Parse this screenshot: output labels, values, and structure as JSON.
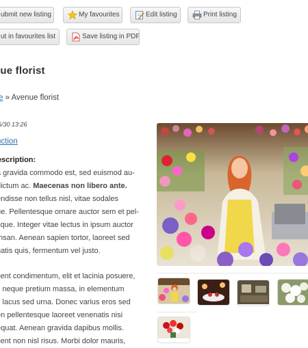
{
  "toolbar": {
    "submit_label": "ubmit new listing",
    "favourites_label": "My favourites",
    "edit_label": "Edit listing",
    "print_label": "Print listing",
    "put_fav_label": "ut in favourites list",
    "pdf_label": "Save listing in PDF"
  },
  "listing": {
    "title": "nue florist",
    "breadcrumb_link": "e",
    "breadcrumb_sep": " » ",
    "breadcrumb_current": "Avenue florist",
    "date": "6/30 13:26",
    "category": "truction",
    "description_heading": "Description:",
    "para1": [
      {
        "pre": "a gravida commodo est, sed euismod au-",
        "bold": "",
        "post": ""
      },
      {
        "pre": "dictum ac. ",
        "bold": "Maecenas non libero ante.",
        "post": ""
      },
      {
        "pre": "endisse non tellus nisl, vitae sodales",
        "bold": "",
        "post": ""
      },
      {
        "pre": "ue. Pellentesque ornare auctor sem et pel-",
        "bold": "",
        "post": ""
      },
      {
        "pre": "sque. Integer vitae lectus in ipsum auctor",
        "bold": "",
        "post": ""
      },
      {
        "pre": "msan. Aenean sapien tortor, laoreet sed",
        "bold": "",
        "post": ""
      },
      {
        "pre": "natis quis, fermentum vel justo.",
        "bold": "",
        "post": ""
      }
    ],
    "para2": [
      "sent condimentum, elit et lacinia posuere,",
      "s neque pretium massa, in elementum",
      "s lacus sed urna. Donec varius eros sed",
      "en pellentesque laoreet venenatis nisi",
      "equat. Aenean gravida dapibus mollis.",
      "sent non nisl risus. Morbi dolor mauris,"
    ]
  },
  "gallery": {
    "main_image": "florist-woman-photo",
    "thumbnails": [
      "florist-woman",
      "restaurant-interior",
      "room-interior",
      "white-flowers",
      "red-bouquet"
    ]
  },
  "colors": {
    "link": "#2a6fb0",
    "button_border": "#c9c9c9"
  }
}
